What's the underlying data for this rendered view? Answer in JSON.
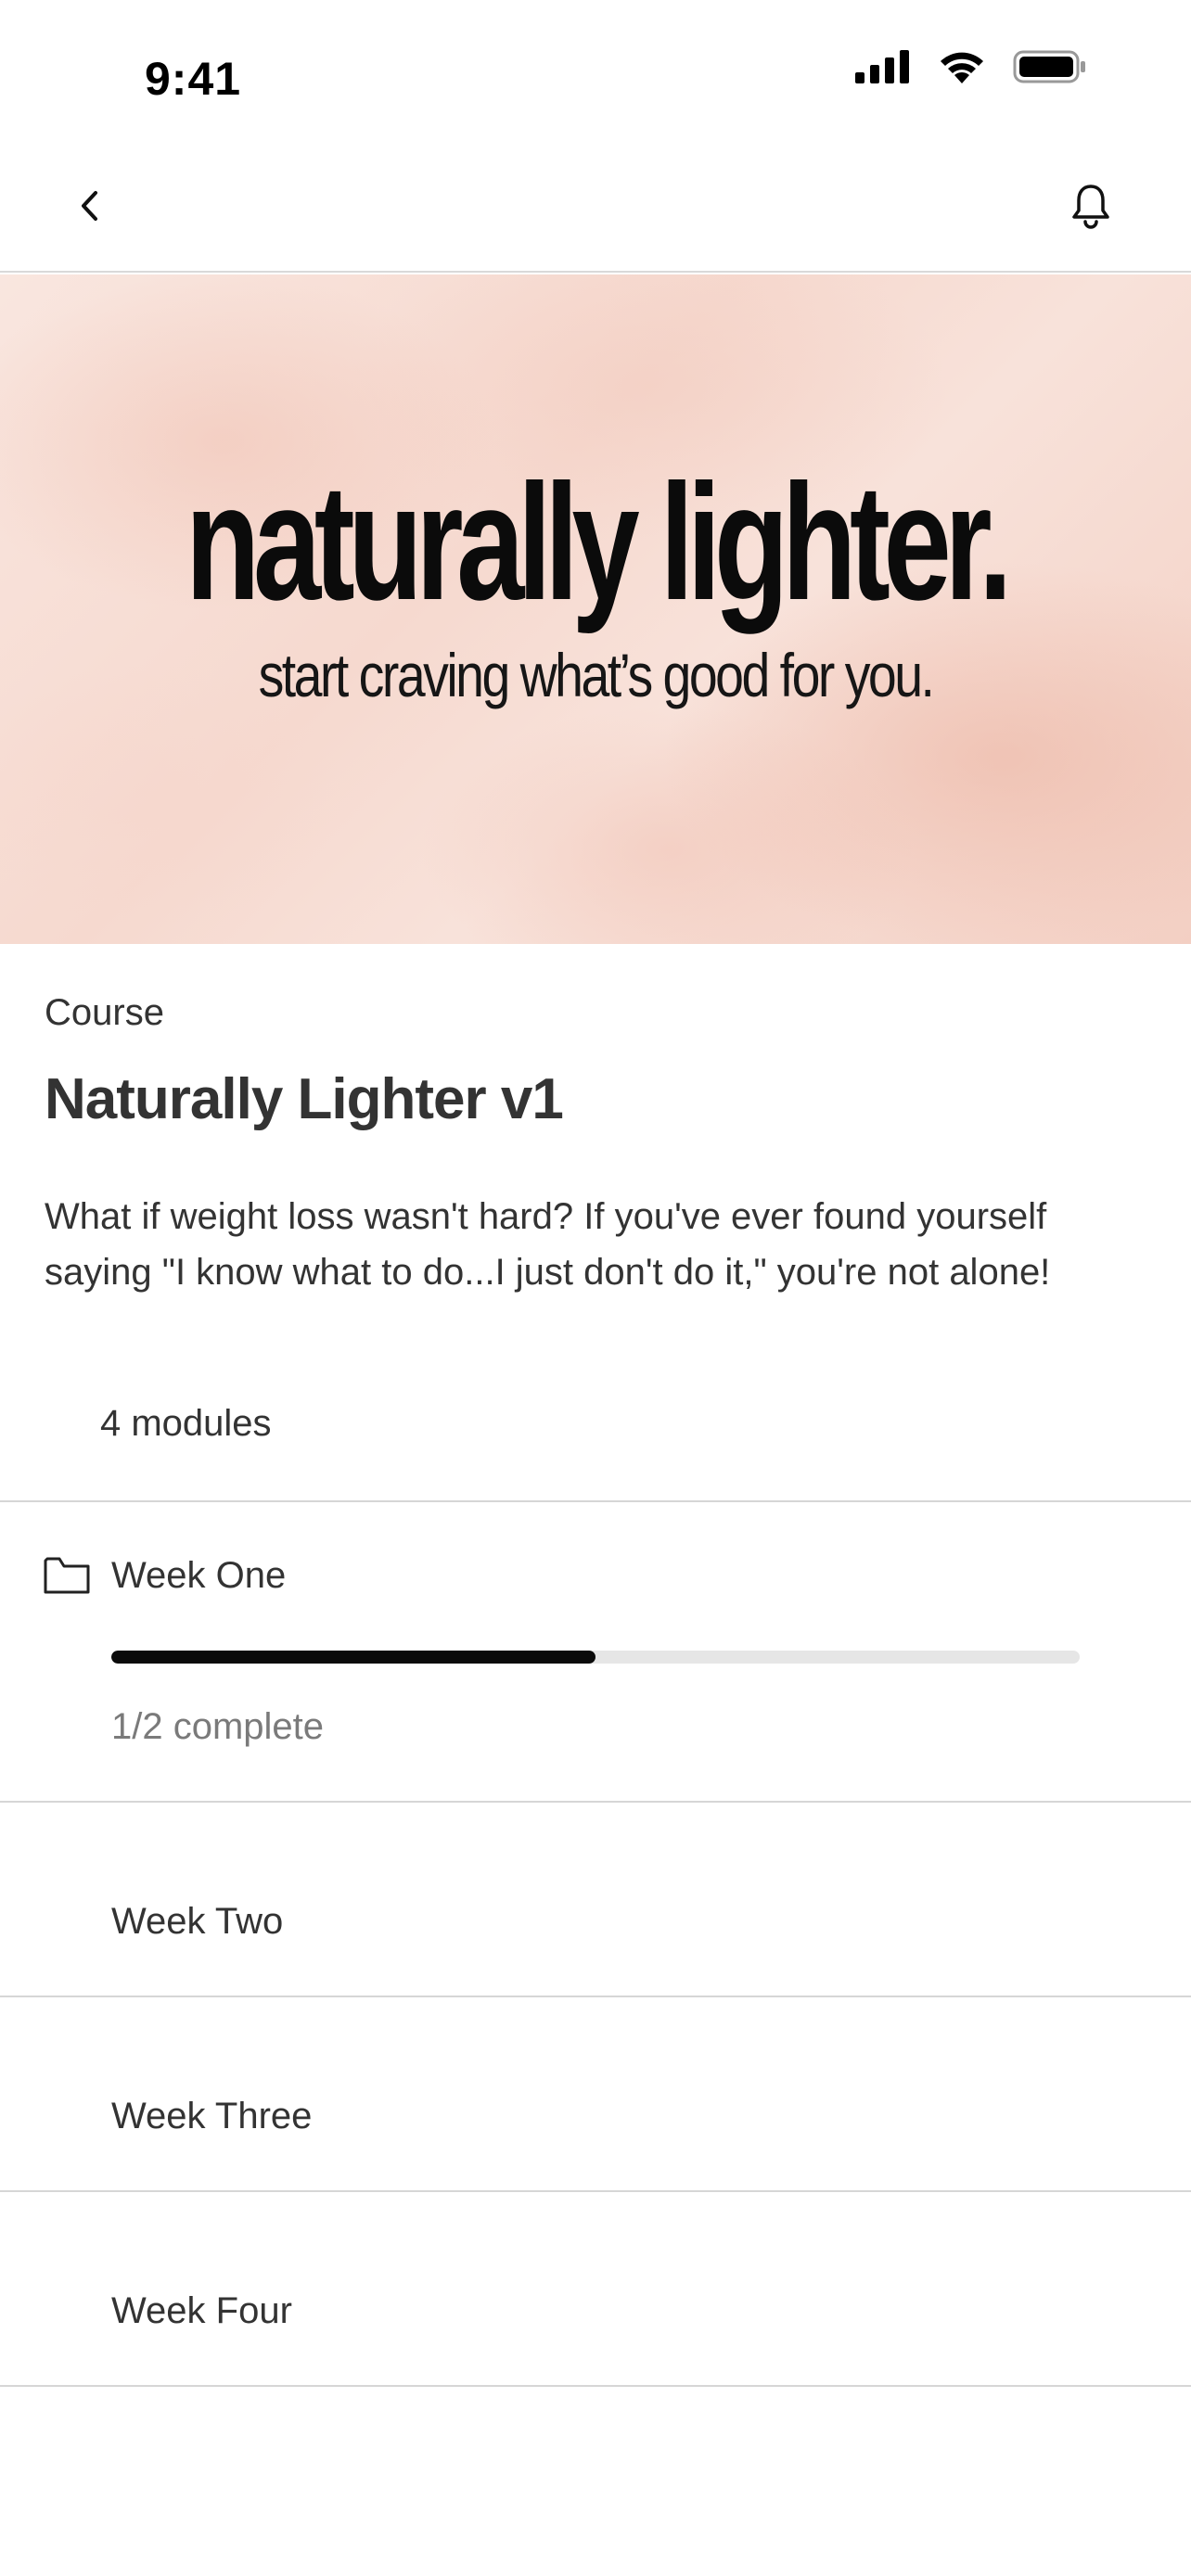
{
  "status_bar": {
    "time": "9:41",
    "icons": [
      "cellular-signal-icon",
      "wifi-icon",
      "battery-icon"
    ]
  },
  "nav": {
    "back_icon": "chevron-left-icon",
    "notification_icon": "bell-icon"
  },
  "hero": {
    "title": "naturally lighter.",
    "subtitle": "start craving what’s good for you."
  },
  "course": {
    "label": "Course",
    "title": "Naturally Lighter v1",
    "description": "What if weight loss wasn't hard? If you've ever found yourself saying \"I know what to do...I just don't do it,\" you're not alone!",
    "modules_count": "4 modules"
  },
  "modules": [
    {
      "name": "Week One",
      "icon": "folder-icon",
      "progress_text": "1/2 complete",
      "progress_fraction": 0.5
    },
    {
      "name": "Week Two"
    },
    {
      "name": "Week Three"
    },
    {
      "name": "Week Four"
    }
  ],
  "colors": {
    "progress_fill": "#0b0b0b",
    "progress_track": "#e6e6e6",
    "divider": "#d6d6d6"
  }
}
